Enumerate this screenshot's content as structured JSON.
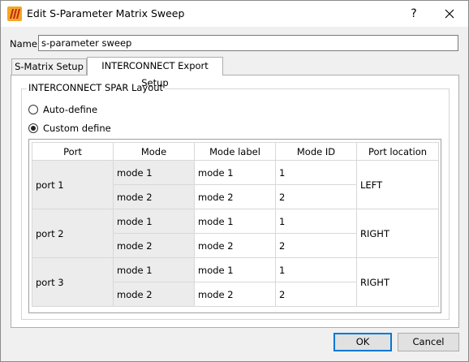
{
  "window": {
    "title": "Edit S-Parameter Matrix Sweep",
    "help": "?"
  },
  "name_field": {
    "label": "Name:",
    "value": "s-parameter sweep"
  },
  "tabs": [
    {
      "label": "S-Matrix Setup"
    },
    {
      "label": "INTERCONNECT Export Setup"
    }
  ],
  "layout_group": {
    "title": "INTERCONNECT SPAR Layout",
    "options": [
      {
        "label": "Auto-define",
        "checked": false
      },
      {
        "label": "Custom define",
        "checked": true
      }
    ]
  },
  "table": {
    "headers": [
      "Port",
      "Mode",
      "Mode label",
      "Mode ID",
      "Port location"
    ],
    "ports": [
      {
        "port": "port 1",
        "location": "LEFT",
        "modes": [
          {
            "mode": "mode 1",
            "label": "mode 1",
            "id": "1"
          },
          {
            "mode": "mode 2",
            "label": "mode 2",
            "id": "2"
          }
        ]
      },
      {
        "port": "port 2",
        "location": "RIGHT",
        "modes": [
          {
            "mode": "mode 1",
            "label": "mode 1",
            "id": "1"
          },
          {
            "mode": "mode 2",
            "label": "mode 2",
            "id": "2"
          }
        ]
      },
      {
        "port": "port 3",
        "location": "RIGHT",
        "modes": [
          {
            "mode": "mode 1",
            "label": "mode 1",
            "id": "1"
          },
          {
            "mode": "mode 2",
            "label": "mode 2",
            "id": "2"
          }
        ]
      }
    ]
  },
  "buttons": {
    "ok": "OK",
    "cancel": "Cancel"
  },
  "icons": {
    "app": "lumerical-app-icon",
    "close": "close-icon"
  },
  "colors": {
    "accent": "#0078d7",
    "cell_gray": "#ececec"
  }
}
